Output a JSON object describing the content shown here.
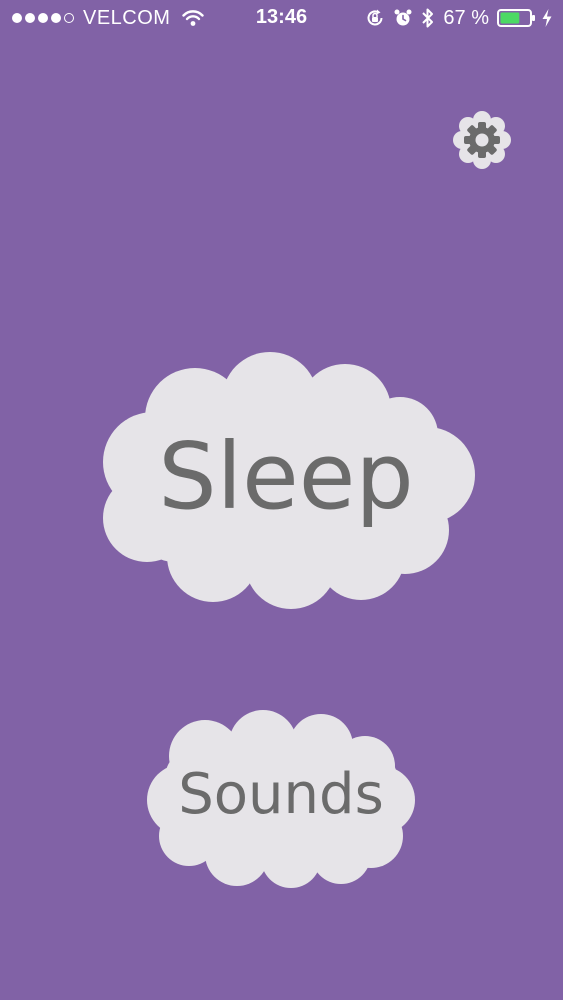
{
  "status_bar": {
    "carrier": "VELCOM",
    "time": "13:46",
    "battery_percent": "67 %",
    "battery_level": 0.67,
    "signal_bars_filled": 4,
    "signal_bars_total": 5
  },
  "icons": {
    "wifi": "wifi-icon",
    "orientation_lock": "orientation-lock-icon",
    "alarm": "alarm-icon",
    "bluetooth": "bluetooth-icon",
    "battery": "battery-icon",
    "charging": "charging-bolt-icon",
    "settings": "gear-icon"
  },
  "main": {
    "sleep_label": "Sleep",
    "sounds_label": "Sounds"
  },
  "colors": {
    "background": "#8162a6",
    "cloud": "#e6e4e8",
    "label_text": "#6b6b6b",
    "battery_fill": "#4cd964"
  }
}
